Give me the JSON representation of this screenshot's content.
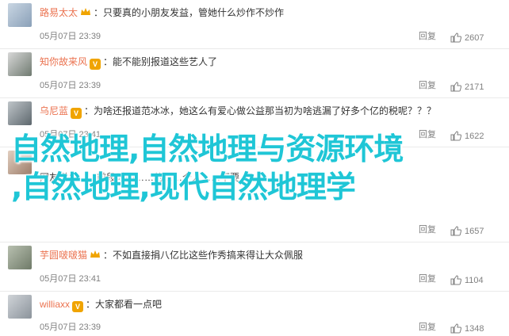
{
  "comments": [
    {
      "name": "路易太太",
      "badge": "crown",
      "text": "只要真的小朋友发益，管她什么炒作不炒作",
      "time": "05月07日 23:39",
      "reply": "回复",
      "likes": "2607"
    },
    {
      "name": "知你故来风",
      "badge": "vip",
      "text": "能不能别报道这些艺人了",
      "time": "05月07日 23:39",
      "reply": "回复",
      "likes": "2171"
    },
    {
      "name": "乌尼蓝",
      "badge": "vip",
      "text": "为啥还报道范冰冰，她这么有爱心做公益那当初为啥逃漏了好多个亿的税呢？？？",
      "time": "05月07日 23:41",
      "reply": "回复",
      "likes": "1622"
    },
    {
      "name": "",
      "badge": "",
      "text": "网友说：……前段时间……的……个人……不要",
      "time": "",
      "reply": "回复",
      "likes": "1657"
    },
    {
      "name": "芋圆啵啵猫",
      "badge": "crown",
      "text": "不如直接捐八亿比这些作秀搞来得让大众佩服",
      "time": "05月07日 23:41",
      "reply": "回复",
      "likes": "1104"
    },
    {
      "name": "williaxx",
      "badge": "vip",
      "text": "大家都看一点吧",
      "time": "05月07日 23:39",
      "reply": "回复",
      "likes": "1348"
    }
  ],
  "overlay": {
    "line1": "自然地理,自然地理与资源环境",
    "line2": ",自然地理,现代自然地理学"
  },
  "colors": {
    "username": "#eb7350",
    "overlay": "#1fc6d6",
    "meta": "#808080"
  }
}
